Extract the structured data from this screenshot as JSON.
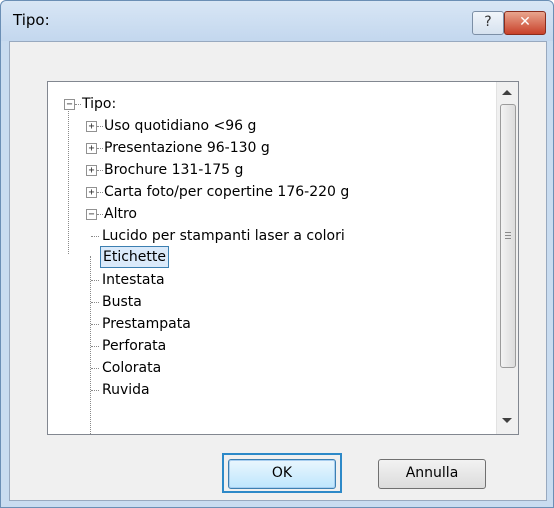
{
  "window": {
    "title": "Tipo:",
    "help_label": "?",
    "close_label": "✕"
  },
  "tree": {
    "root": {
      "label": "Tipo:",
      "expander": "−"
    },
    "items": [
      {
        "label": "Uso quotidiano <96 g",
        "expander": "+"
      },
      {
        "label": "Presentazione 96-130 g",
        "expander": "+"
      },
      {
        "label": "Brochure 131-175 g",
        "expander": "+"
      },
      {
        "label": "Carta foto/per copertine 176-220 g",
        "expander": "+"
      },
      {
        "label": "Altro",
        "expander": "−"
      }
    ],
    "children": [
      {
        "label": "Lucido per stampanti laser a colori"
      },
      {
        "label": "Etichette",
        "selected": true
      },
      {
        "label": "Intestata"
      },
      {
        "label": "Busta"
      },
      {
        "label": "Prestampata"
      },
      {
        "label": "Perforata"
      },
      {
        "label": "Colorata"
      },
      {
        "label": "Ruvida"
      }
    ]
  },
  "buttons": {
    "ok": "OK",
    "cancel": "Annulla"
  },
  "colors": {
    "selection_border": "#3c7fb1",
    "close_button": "#c8412a",
    "title_bar": "#c9dcf0"
  }
}
